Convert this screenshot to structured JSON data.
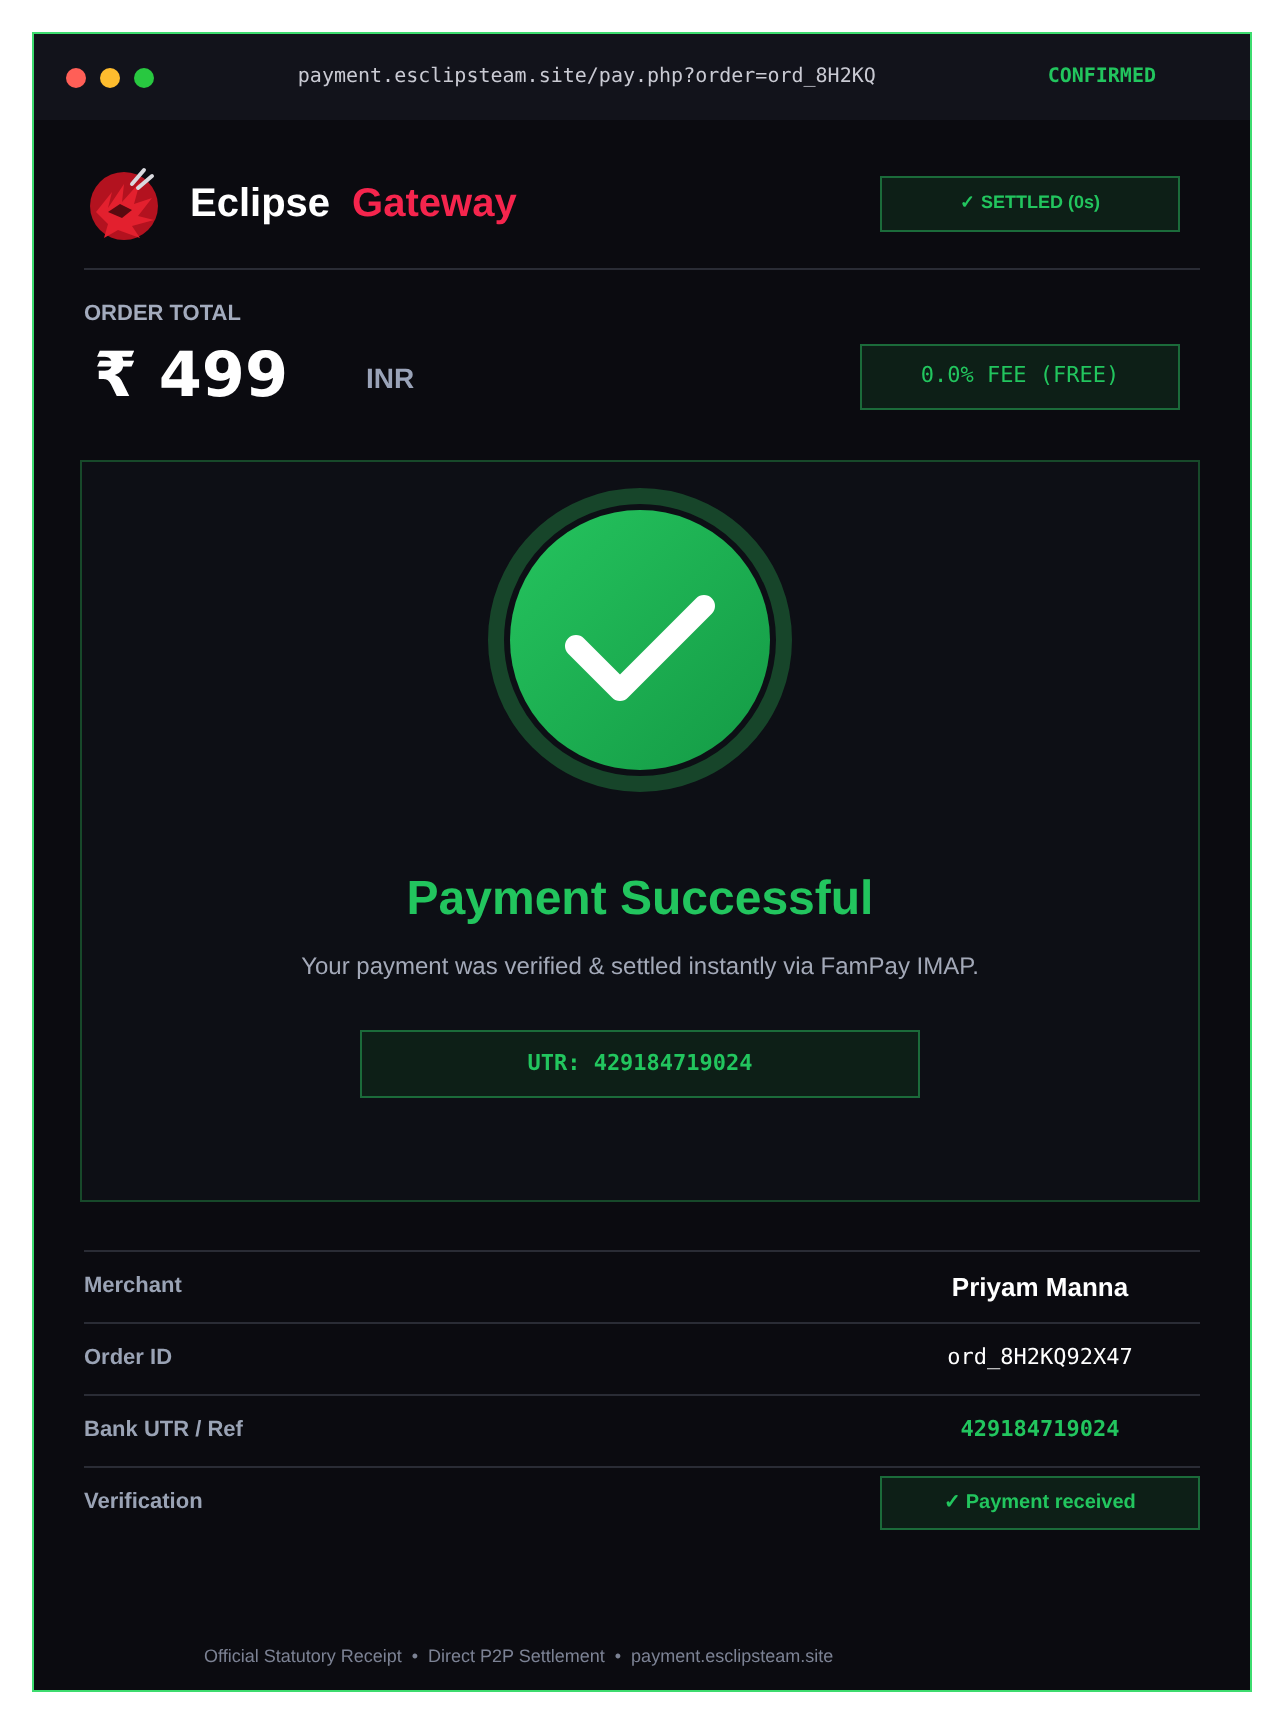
{
  "window": {
    "traffic_lights": [
      {
        "color": "#ff5f57"
      },
      {
        "color": "#febc2e"
      },
      {
        "color": "#28c840"
      }
    ],
    "url": "payment.esclipsteam.site/pay.php?order=ord_8H2KQ",
    "status": "CONFIRMED"
  },
  "header": {
    "brand": [
      {
        "text": "Eclipse",
        "kind": "primary"
      },
      {
        "text": "Gateway",
        "kind": "accent"
      }
    ],
    "badge": "✓ SETTLED (0s)"
  },
  "order": {
    "label": "ORDER TOTAL",
    "amount": "₹ 499",
    "currency": "INR",
    "fee": "0.0% FEE (FREE)"
  },
  "result": {
    "title": "Payment Successful",
    "message": "Your payment was verified & settled instantly via FamPay IMAP.",
    "utr": "UTR: 429184719024"
  },
  "details": [
    {
      "label": "Merchant",
      "value": "Priyam Manna",
      "kind": "name"
    },
    {
      "label": "Order ID",
      "value": "ord_8H2KQ92X47",
      "kind": "code"
    },
    {
      "label": "Bank UTR / Ref",
      "value": "429184719024",
      "kind": "highlight"
    },
    {
      "label": "Verification",
      "value": "✓ Payment received",
      "kind": "badge"
    }
  ],
  "footer": "Official Statutory Receipt  •  Direct P2P Settlement  •  payment.esclipsteam.site"
}
